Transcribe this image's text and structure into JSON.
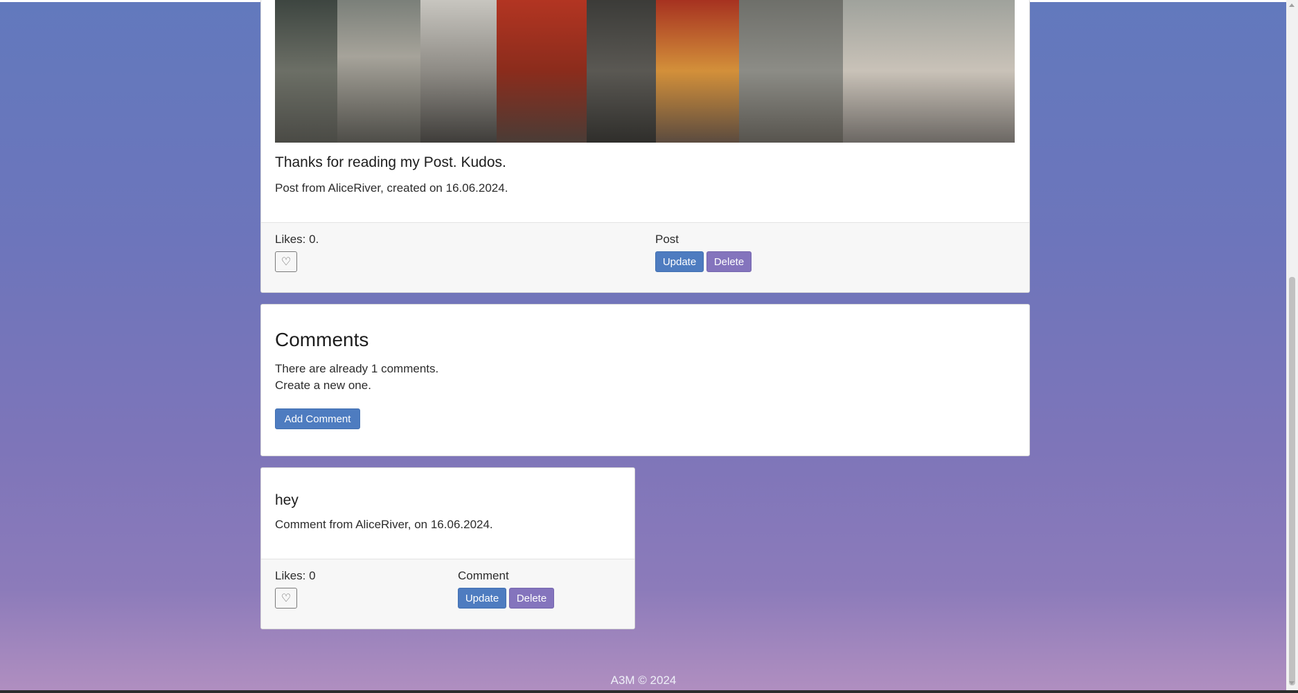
{
  "post": {
    "title": "Thanks for reading my Post. Kudos.",
    "meta": "Post from AliceRiver, created on 16.06.2024.",
    "likes": "Likes: 0.",
    "section_label": "Post",
    "update_label": "Update",
    "delete_label": "Delete"
  },
  "comments_section": {
    "heading": "Comments",
    "count_text": "There are already 1 comments.",
    "cta_text": "Create a new one.",
    "add_label": "Add Comment"
  },
  "comment": {
    "title": "hey",
    "meta": "Comment from AliceRiver, on 16.06.2024.",
    "likes": "Likes: 0",
    "section_label": "Comment",
    "update_label": "Update",
    "delete_label": "Delete"
  },
  "footer": {
    "copyright": "A3M © 2024"
  },
  "icons": {
    "like": "heart-outline-icon"
  },
  "colors": {
    "primary_button": "#4e7cc0",
    "danger_button": "#8474bd"
  }
}
